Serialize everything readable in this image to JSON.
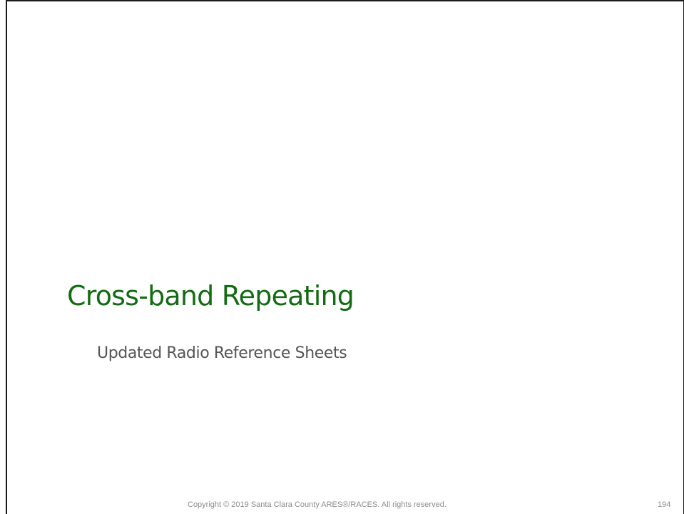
{
  "slide": {
    "title": "Cross-band Repeating",
    "subtitle": "Updated Radio Reference Sheets",
    "title_color": "#146b14",
    "subtitle_color": "#555555"
  },
  "footer": {
    "copyright": "Copyright © 2019 Santa Clara County ARES®/RACES.  All rights reserved.",
    "page_number": "194"
  }
}
